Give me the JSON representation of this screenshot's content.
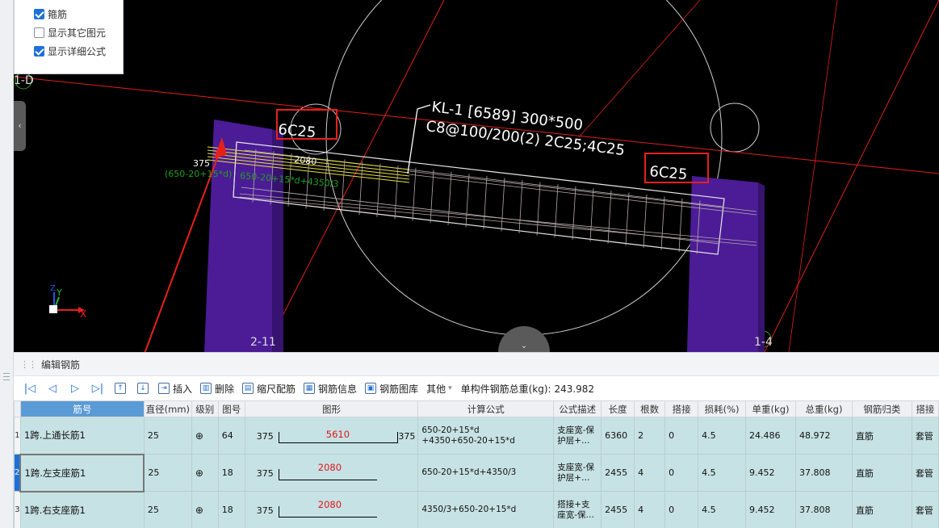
{
  "options": [
    {
      "label": "箍筋",
      "checked": true
    },
    {
      "label": "显示其它图元",
      "checked": false
    },
    {
      "label": "显示详细公式",
      "checked": true
    }
  ],
  "viewport": {
    "axis_labels": [
      "1-D",
      "2-11",
      "1-4"
    ],
    "beam_label_line1": "KL-1 [6589] 300*500",
    "beam_label_line2": "C8@100/200(2) 2C25;4C25",
    "rebar_tag_left": "6C25",
    "rebar_tag_right": "6C25",
    "dim_375": "375",
    "dim_2080": "2080",
    "formula_green_1": "(650-20+15*d)",
    "formula_green_2": "650-20+15*d+4350/3",
    "axis_x": "X",
    "axis_y": "Y",
    "axis_z": "Z"
  },
  "editor": {
    "title": "编辑钢筋",
    "toolbar": {
      "insert": "插入",
      "delete": "删除",
      "scale": "缩尺配筋",
      "info": "钢筋信息",
      "library": "钢筋图库",
      "other": "其他",
      "total_label": "单构件钢筋总重(kg):",
      "total_value": "243.982"
    },
    "headers": [
      "筋号",
      "直径(mm)",
      "级别",
      "图号",
      "图形",
      "计算公式",
      "公式描述",
      "长度",
      "根数",
      "搭接",
      "损耗(%)",
      "单重(kg)",
      "总重(kg)",
      "钢筋归类",
      "搭接"
    ],
    "rows": [
      {
        "no": "1",
        "name": "1跨.上通长筋1",
        "dia": "25",
        "grade": "⊕",
        "fig": "64",
        "shape_left": "375",
        "shape_mid": "5610",
        "shape_right": "375",
        "formula": "650-20+15*d\n+4350+650-20+15*d",
        "desc": "支座宽-保护层+…",
        "len": "6360",
        "count": "2",
        "lap": "0",
        "loss": "4.5",
        "unit": "24.486",
        "total": "48.972",
        "cat": "直筋",
        "lap2": "套管"
      },
      {
        "no": "2",
        "name": "1跨.左支座筋1",
        "dia": "25",
        "grade": "⊕",
        "fig": "18",
        "shape_left": "375",
        "shape_mid": "2080",
        "shape_right": "",
        "formula": "650-20+15*d+4350/3",
        "desc": "支座宽-保护层+…",
        "len": "2455",
        "count": "4",
        "lap": "0",
        "loss": "4.5",
        "unit": "9.452",
        "total": "37.808",
        "cat": "直筋",
        "lap2": "套管"
      },
      {
        "no": "3",
        "name": "1跨.右支座筋1",
        "dia": "25",
        "grade": "⊕",
        "fig": "18",
        "shape_left": "375",
        "shape_mid": "2080",
        "shape_right": "",
        "formula": "4350/3+650-20+15*d",
        "desc": "搭接+支座宽-保…",
        "len": "2455",
        "count": "4",
        "lap": "0",
        "loss": "4.5",
        "unit": "9.452",
        "total": "37.808",
        "cat": "直筋",
        "lap2": "套管"
      }
    ]
  },
  "colors": {
    "column": "#4b1c96",
    "highlight_box": "#e8201a",
    "annotation_arrow": "#e8201a",
    "rebar_yellow": "#e6e040",
    "row_bg": "#c7e2e4",
    "header_highlight": "#5b9bd5"
  }
}
